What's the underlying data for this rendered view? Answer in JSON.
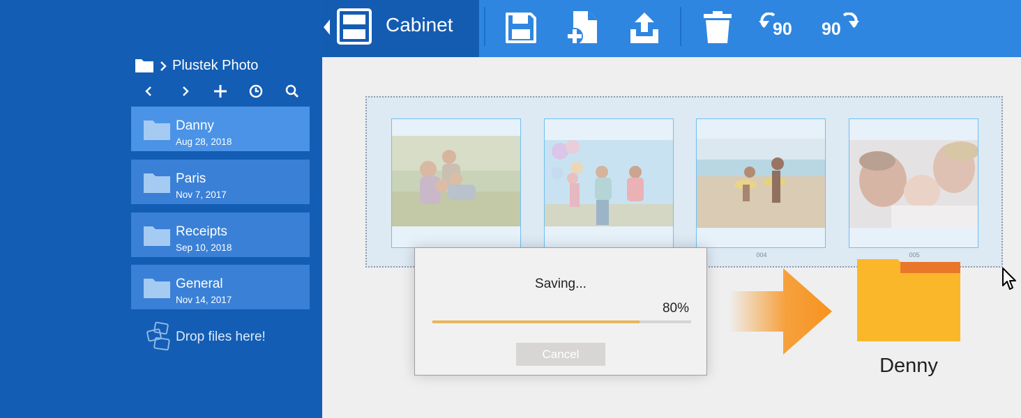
{
  "toolbar": {
    "back_icon": "chevron-left-icon",
    "cabinet_label": "Cabinet",
    "rotate_left_label": "90",
    "rotate_right_label": "90"
  },
  "sidebar": {
    "breadcrumb_label": "Plustek Photo",
    "folders": [
      {
        "name": "Danny",
        "date": "Aug 28, 2018",
        "selected": true
      },
      {
        "name": "Paris",
        "date": "Nov 7, 2017",
        "selected": false
      },
      {
        "name": "Receipts",
        "date": "Sep 10, 2018",
        "selected": false
      },
      {
        "name": "General",
        "date": "Nov 14, 2017",
        "selected": false
      }
    ],
    "drop_label": "Drop files here!"
  },
  "photos": {
    "cards": [
      {
        "label": ""
      },
      {
        "label": ""
      },
      {
        "label": "004"
      },
      {
        "label": "005"
      }
    ]
  },
  "dialog": {
    "title": "Saving...",
    "percent_text": "80%",
    "progress": 0.8,
    "cancel_label": "Cancel"
  },
  "destination": {
    "folder_label": "Denny"
  },
  "colors": {
    "sidebar": "#135db4",
    "toolbar": "#2f86e0",
    "accent_orange": "#f7931e",
    "folder_yellow": "#fbb72a",
    "progress_fill": "#e7b55a"
  }
}
